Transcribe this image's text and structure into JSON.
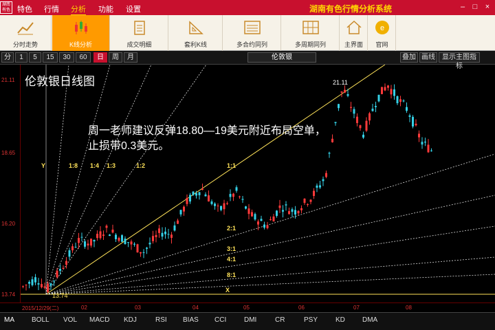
{
  "menubar": {
    "items": [
      "特色",
      "行情",
      "分析",
      "功能",
      "设置"
    ],
    "active": 2,
    "app_title": "湖南有色行情分析系统",
    "logo": "湖南有色"
  },
  "toolbar": {
    "items": [
      {
        "label": "分时走势",
        "icon": "trend-line-icon"
      },
      {
        "label": "K线分析",
        "icon": "candlestick-icon"
      },
      {
        "label": "成交明细",
        "icon": "clipboard-icon"
      },
      {
        "label": "套利K线",
        "icon": "ruler-triangle-icon"
      },
      {
        "label": "多合约同列",
        "icon": "list-window-icon"
      },
      {
        "label": "多周期同列",
        "icon": "grid-window-icon"
      },
      {
        "label": "主界面",
        "icon": "home-icon"
      },
      {
        "label": "官网",
        "icon": "globe-icon"
      }
    ],
    "active": 1
  },
  "periodbar": {
    "items": [
      "分",
      "1",
      "5",
      "15",
      "30",
      "60",
      "日",
      "周",
      "月"
    ],
    "active": 6,
    "symbol": "伦敦银",
    "right_buttons": [
      "叠加",
      "画线",
      "显示主图指标"
    ]
  },
  "chart": {
    "title": "伦敦银日线图",
    "annotation_line1": "周一老师建议反弹18.80—19美元附近布局空单，",
    "annotation_line2": "止损带0.3美元。",
    "y_ticks": [
      "21.11",
      "18.65",
      "16.20",
      "13.74"
    ],
    "x_ticks": [
      "2015/12/29(二)",
      "02",
      "03",
      "04",
      "05",
      "06",
      "07",
      "08"
    ],
    "high_label": "21.11",
    "low_label": "13.74",
    "gann_upper": [
      "1:8",
      "1:4",
      "1:3",
      "1:2"
    ],
    "gann_lower": [
      "1:1",
      "2:1",
      "3:1",
      "4:1",
      "8:1"
    ],
    "y_marker": "Y",
    "x_marker": "X",
    "ylim": [
      13.74,
      21.11
    ]
  },
  "chart_data": {
    "type": "candlestick",
    "title": "伦敦银日线图",
    "y_ticks": [
      21.11,
      18.65,
      16.2,
      13.74
    ],
    "x_ticks": [
      "2015/12/29(二)",
      "02",
      "03",
      "04",
      "05",
      "06",
      "07",
      "08"
    ],
    "ylim": [
      13.74,
      21.11
    ],
    "labeled_values": {
      "high": 21.11,
      "low": 13.74
    }
  },
  "indicators": [
    "MA",
    "BOLL",
    "VOL",
    "MACD",
    "KDJ",
    "RSI",
    "BIAS",
    "CCI",
    "DMI",
    "CR",
    "PSY",
    "KD",
    "DMA"
  ],
  "colors": {
    "up": "#ff3a3a",
    "down": "#35d0e6",
    "gann": "#ffe35a",
    "accent": "#c8102e",
    "toolbar_active": "#ff9a00"
  }
}
